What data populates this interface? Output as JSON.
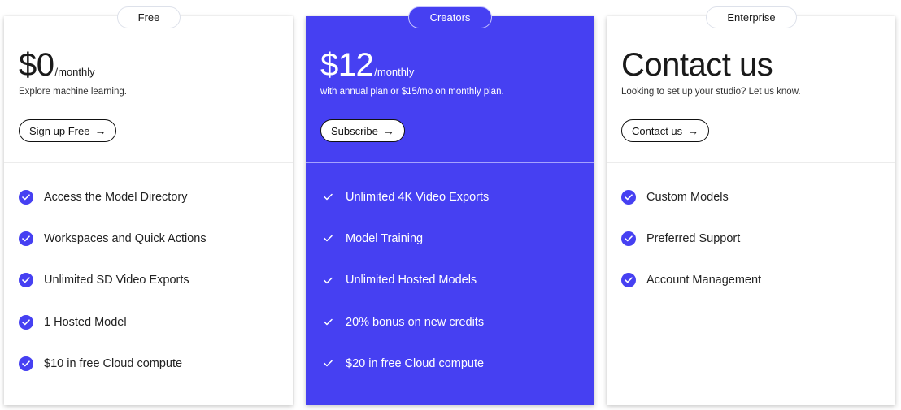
{
  "colors": {
    "accent": "#4640f2",
    "card_bg": "#ffffff",
    "text": "#1a1a1a"
  },
  "plans": [
    {
      "badge": "Free",
      "price": "$0",
      "period": "/monthly",
      "description": "Explore machine learning.",
      "cta_label": "Sign up Free",
      "cta_icon": "arrow-right-icon",
      "features": [
        "Access the Model Directory",
        "Workspaces and Quick Actions",
        "Unlimited SD Video Exports",
        "1 Hosted Model",
        "$10 in free Cloud compute"
      ]
    },
    {
      "badge": "Creators",
      "price": "$12",
      "period": "/monthly",
      "description": "with annual plan or $15/mo on monthly plan.",
      "cta_label": "Subscribe",
      "cta_icon": "arrow-right-icon",
      "features": [
        "Unlimited 4K Video Exports",
        "Model Training",
        "Unlimited Hosted Models",
        "20% bonus on new credits",
        "$20 in free Cloud compute"
      ]
    },
    {
      "badge": "Enterprise",
      "price": "Contact us",
      "period": "",
      "description": "Looking to set up your studio? Let us know.",
      "cta_label": "Contact us",
      "cta_icon": "arrow-right-icon",
      "features": [
        "Custom Models",
        "Preferred Support",
        "Account Management"
      ]
    }
  ]
}
